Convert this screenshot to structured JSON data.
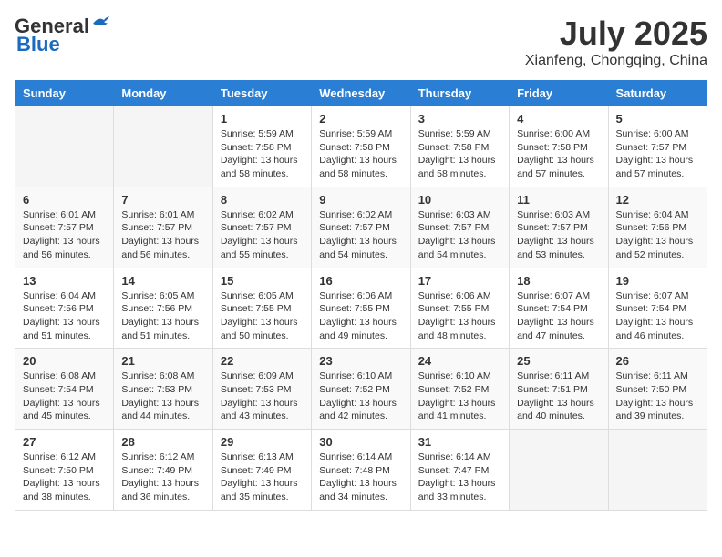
{
  "header": {
    "logo_general": "General",
    "logo_blue": "Blue",
    "title": "July 2025",
    "subtitle": "Xianfeng, Chongqing, China"
  },
  "calendar": {
    "weekdays": [
      "Sunday",
      "Monday",
      "Tuesday",
      "Wednesday",
      "Thursday",
      "Friday",
      "Saturday"
    ],
    "weeks": [
      [
        {
          "day": "",
          "sunrise": "",
          "sunset": "",
          "daylight": ""
        },
        {
          "day": "",
          "sunrise": "",
          "sunset": "",
          "daylight": ""
        },
        {
          "day": "1",
          "sunrise": "Sunrise: 5:59 AM",
          "sunset": "Sunset: 7:58 PM",
          "daylight": "Daylight: 13 hours and 58 minutes."
        },
        {
          "day": "2",
          "sunrise": "Sunrise: 5:59 AM",
          "sunset": "Sunset: 7:58 PM",
          "daylight": "Daylight: 13 hours and 58 minutes."
        },
        {
          "day": "3",
          "sunrise": "Sunrise: 5:59 AM",
          "sunset": "Sunset: 7:58 PM",
          "daylight": "Daylight: 13 hours and 58 minutes."
        },
        {
          "day": "4",
          "sunrise": "Sunrise: 6:00 AM",
          "sunset": "Sunset: 7:58 PM",
          "daylight": "Daylight: 13 hours and 57 minutes."
        },
        {
          "day": "5",
          "sunrise": "Sunrise: 6:00 AM",
          "sunset": "Sunset: 7:57 PM",
          "daylight": "Daylight: 13 hours and 57 minutes."
        }
      ],
      [
        {
          "day": "6",
          "sunrise": "Sunrise: 6:01 AM",
          "sunset": "Sunset: 7:57 PM",
          "daylight": "Daylight: 13 hours and 56 minutes."
        },
        {
          "day": "7",
          "sunrise": "Sunrise: 6:01 AM",
          "sunset": "Sunset: 7:57 PM",
          "daylight": "Daylight: 13 hours and 56 minutes."
        },
        {
          "day": "8",
          "sunrise": "Sunrise: 6:02 AM",
          "sunset": "Sunset: 7:57 PM",
          "daylight": "Daylight: 13 hours and 55 minutes."
        },
        {
          "day": "9",
          "sunrise": "Sunrise: 6:02 AM",
          "sunset": "Sunset: 7:57 PM",
          "daylight": "Daylight: 13 hours and 54 minutes."
        },
        {
          "day": "10",
          "sunrise": "Sunrise: 6:03 AM",
          "sunset": "Sunset: 7:57 PM",
          "daylight": "Daylight: 13 hours and 54 minutes."
        },
        {
          "day": "11",
          "sunrise": "Sunrise: 6:03 AM",
          "sunset": "Sunset: 7:57 PM",
          "daylight": "Daylight: 13 hours and 53 minutes."
        },
        {
          "day": "12",
          "sunrise": "Sunrise: 6:04 AM",
          "sunset": "Sunset: 7:56 PM",
          "daylight": "Daylight: 13 hours and 52 minutes."
        }
      ],
      [
        {
          "day": "13",
          "sunrise": "Sunrise: 6:04 AM",
          "sunset": "Sunset: 7:56 PM",
          "daylight": "Daylight: 13 hours and 51 minutes."
        },
        {
          "day": "14",
          "sunrise": "Sunrise: 6:05 AM",
          "sunset": "Sunset: 7:56 PM",
          "daylight": "Daylight: 13 hours and 51 minutes."
        },
        {
          "day": "15",
          "sunrise": "Sunrise: 6:05 AM",
          "sunset": "Sunset: 7:55 PM",
          "daylight": "Daylight: 13 hours and 50 minutes."
        },
        {
          "day": "16",
          "sunrise": "Sunrise: 6:06 AM",
          "sunset": "Sunset: 7:55 PM",
          "daylight": "Daylight: 13 hours and 49 minutes."
        },
        {
          "day": "17",
          "sunrise": "Sunrise: 6:06 AM",
          "sunset": "Sunset: 7:55 PM",
          "daylight": "Daylight: 13 hours and 48 minutes."
        },
        {
          "day": "18",
          "sunrise": "Sunrise: 6:07 AM",
          "sunset": "Sunset: 7:54 PM",
          "daylight": "Daylight: 13 hours and 47 minutes."
        },
        {
          "day": "19",
          "sunrise": "Sunrise: 6:07 AM",
          "sunset": "Sunset: 7:54 PM",
          "daylight": "Daylight: 13 hours and 46 minutes."
        }
      ],
      [
        {
          "day": "20",
          "sunrise": "Sunrise: 6:08 AM",
          "sunset": "Sunset: 7:54 PM",
          "daylight": "Daylight: 13 hours and 45 minutes."
        },
        {
          "day": "21",
          "sunrise": "Sunrise: 6:08 AM",
          "sunset": "Sunset: 7:53 PM",
          "daylight": "Daylight: 13 hours and 44 minutes."
        },
        {
          "day": "22",
          "sunrise": "Sunrise: 6:09 AM",
          "sunset": "Sunset: 7:53 PM",
          "daylight": "Daylight: 13 hours and 43 minutes."
        },
        {
          "day": "23",
          "sunrise": "Sunrise: 6:10 AM",
          "sunset": "Sunset: 7:52 PM",
          "daylight": "Daylight: 13 hours and 42 minutes."
        },
        {
          "day": "24",
          "sunrise": "Sunrise: 6:10 AM",
          "sunset": "Sunset: 7:52 PM",
          "daylight": "Daylight: 13 hours and 41 minutes."
        },
        {
          "day": "25",
          "sunrise": "Sunrise: 6:11 AM",
          "sunset": "Sunset: 7:51 PM",
          "daylight": "Daylight: 13 hours and 40 minutes."
        },
        {
          "day": "26",
          "sunrise": "Sunrise: 6:11 AM",
          "sunset": "Sunset: 7:50 PM",
          "daylight": "Daylight: 13 hours and 39 minutes."
        }
      ],
      [
        {
          "day": "27",
          "sunrise": "Sunrise: 6:12 AM",
          "sunset": "Sunset: 7:50 PM",
          "daylight": "Daylight: 13 hours and 38 minutes."
        },
        {
          "day": "28",
          "sunrise": "Sunrise: 6:12 AM",
          "sunset": "Sunset: 7:49 PM",
          "daylight": "Daylight: 13 hours and 36 minutes."
        },
        {
          "day": "29",
          "sunrise": "Sunrise: 6:13 AM",
          "sunset": "Sunset: 7:49 PM",
          "daylight": "Daylight: 13 hours and 35 minutes."
        },
        {
          "day": "30",
          "sunrise": "Sunrise: 6:14 AM",
          "sunset": "Sunset: 7:48 PM",
          "daylight": "Daylight: 13 hours and 34 minutes."
        },
        {
          "day": "31",
          "sunrise": "Sunrise: 6:14 AM",
          "sunset": "Sunset: 7:47 PM",
          "daylight": "Daylight: 13 hours and 33 minutes."
        },
        {
          "day": "",
          "sunrise": "",
          "sunset": "",
          "daylight": ""
        },
        {
          "day": "",
          "sunrise": "",
          "sunset": "",
          "daylight": ""
        }
      ]
    ]
  }
}
